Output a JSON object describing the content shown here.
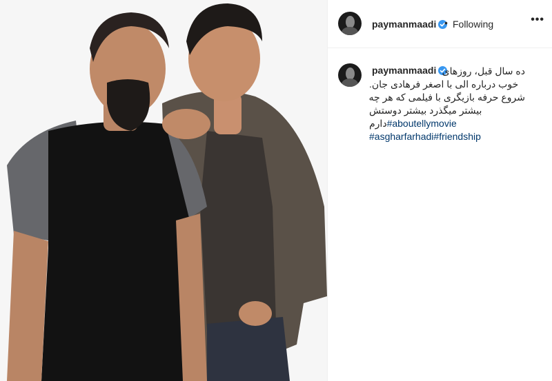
{
  "post": {
    "image_alt": "Two men posing together in front of a white background",
    "more_label": "•••",
    "header": {
      "username": "paymanmaadi",
      "separator": "•",
      "follow_status": "Following"
    },
    "caption": {
      "username": "paymanmaadi",
      "line1": "ده سال قبل، روزهای",
      "line2": "خوب درباره الی با اصغر فرهادی جان.",
      "line3": "شروع حرفه بازیگری با فیلمی که هر چه",
      "line4": "بیشتر میگذرد بیشتر دوستش",
      "line5_text": "دارم",
      "line5_tag": "#aboutellymovie",
      "line6_tag1": "#asgharfarhadi",
      "line6_tag2": "#friendship"
    }
  },
  "colors": {
    "verified_badge": "#3897f0",
    "hashtag": "#00376b",
    "divider": "#efefef",
    "text": "#262626"
  }
}
